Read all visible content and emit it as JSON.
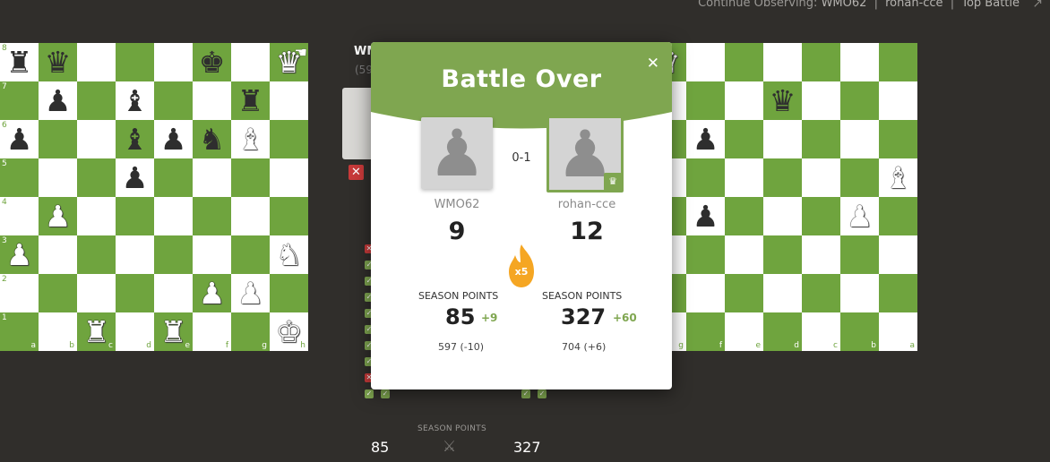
{
  "top_bar": {
    "prefix": "Continue Observing:",
    "player1": "WMO62",
    "player2": "rohan-cce",
    "battle": "Top Battle",
    "separator": "|"
  },
  "board_left": {
    "colors": {
      "light": "#ffffff",
      "dark": "#6fa43e"
    },
    "ranks": [
      "8",
      "7",
      "6",
      "5",
      "4",
      "3",
      "2",
      "1"
    ],
    "files": [
      "a",
      "b",
      "c",
      "d",
      "e",
      "f",
      "g",
      "h"
    ],
    "pieces": [
      "r q . . . k . Q",
      ". p . b . . r .",
      "p . . b p n B .",
      ". . . p . . . .",
      ". P . . . . . .",
      "P . . . . . . N",
      ". . . . . P P .",
      ". . R . R . . K"
    ]
  },
  "board_right": {
    "colors": {
      "light": "#ffffff",
      "dark": "#6fa43e"
    },
    "ranks": [
      "1",
      "2",
      "3",
      "4",
      "5",
      "6",
      "7",
      "8"
    ],
    "files": [
      "h",
      "g",
      "f",
      "e",
      "d",
      "c",
      "b",
      "a"
    ],
    "pieces": [
      ". Q . . . . . .",
      ". . . . q . . .",
      ". . p . . . . .",
      ". . . . . . . B",
      ". . p . . . P .",
      ". . . . . . . .",
      ". . . . . . . .",
      ". . . . . . . ."
    ]
  },
  "background_panel": {
    "player_name": "WM",
    "player_sub": "(59"
  },
  "modal": {
    "title": "Battle Over",
    "close_icon": "close-icon",
    "result": "0-1",
    "left": {
      "name": "WMO62",
      "score": "9",
      "season_label": "SEASON POINTS",
      "season_points": "85",
      "season_gain": "+9",
      "rating": "597 (-10)"
    },
    "right": {
      "name": "rohan-cce",
      "score": "12",
      "season_label": "SEASON POINTS",
      "season_points": "327",
      "season_gain": "+60",
      "rating": "704 (+6)"
    },
    "multiplier": "x5",
    "accent_color": "#7fa650",
    "flame_color": "#f5a623"
  },
  "bottom": {
    "label": "SEASON POINTS",
    "left_points": "85",
    "right_points": "327"
  }
}
